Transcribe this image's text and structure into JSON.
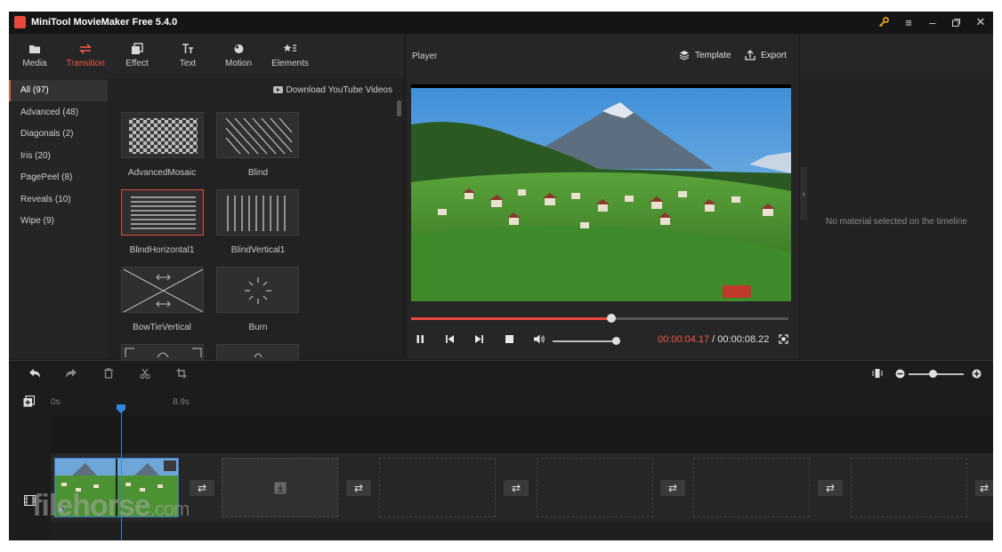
{
  "window": {
    "title": "MiniTool MovieMaker Free 5.4.0"
  },
  "toolbar": {
    "items": [
      {
        "label": "Media",
        "icon": "folder-icon"
      },
      {
        "label": "Transition",
        "icon": "transition-icon",
        "active": true
      },
      {
        "label": "Effect",
        "icon": "effect-icon"
      },
      {
        "label": "Text",
        "icon": "text-icon"
      },
      {
        "label": "Motion",
        "icon": "motion-icon"
      },
      {
        "label": "Elements",
        "icon": "elements-icon"
      }
    ]
  },
  "categories": [
    {
      "label": "All (97)",
      "active": true
    },
    {
      "label": "Advanced (48)"
    },
    {
      "label": "Diagonals (2)"
    },
    {
      "label": "Iris (20)"
    },
    {
      "label": "PagePeel (8)"
    },
    {
      "label": "Reveals (10)"
    },
    {
      "label": "Wipe (9)"
    }
  ],
  "content": {
    "download_link": "Download YouTube Videos",
    "transitions": [
      {
        "label": "AdvancedMosaic"
      },
      {
        "label": "Blind"
      },
      {
        "label": "BlindHorizontal1",
        "selected": true
      },
      {
        "label": "BlindVertical1"
      },
      {
        "label": "BowTieVertical"
      },
      {
        "label": "Burn"
      }
    ]
  },
  "player": {
    "title": "Player",
    "template_label": "Template",
    "export_label": "Export",
    "current_time": "00:00:04.17",
    "separator": " / ",
    "total_time": "00:00:08.22",
    "progress_fraction": 0.53,
    "volume_fraction": 0.97
  },
  "properties": {
    "empty_message": "No material selected on the timeline"
  },
  "timeline": {
    "ruler_start": "0s",
    "ruler_end": "8.9s"
  },
  "watermark": {
    "text": "filehorse",
    "suffix": ".com"
  },
  "colors": {
    "accent": "#f05a4a",
    "playhead": "#2e86de",
    "background": "#1f1f1f"
  }
}
